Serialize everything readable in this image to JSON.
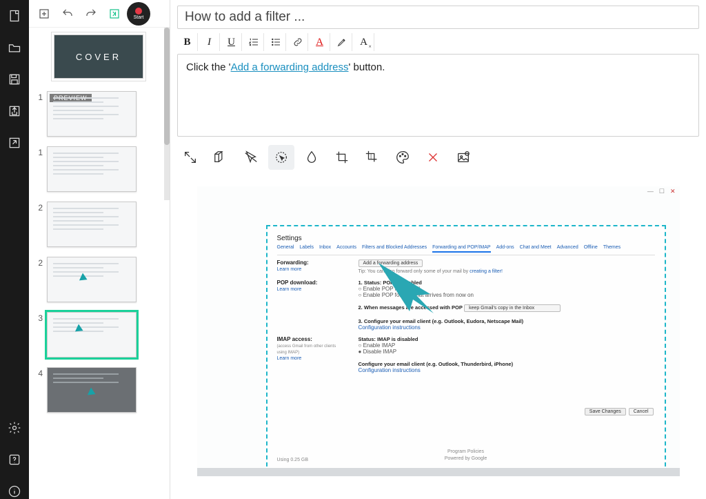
{
  "rail": {
    "items": [
      "new-doc",
      "open",
      "save",
      "export",
      "share",
      "settings",
      "help",
      "info"
    ],
    "record_label": "Start"
  },
  "toolbar": {
    "add": "+",
    "undo": "undo",
    "redo": "redo",
    "merge": "merge"
  },
  "cover_label": "COVER",
  "steps": [
    {
      "num": "1",
      "preview": true
    },
    {
      "num": "1"
    },
    {
      "num": "2"
    },
    {
      "num": "2"
    },
    {
      "num": "3",
      "selected": true
    },
    {
      "num": "4",
      "dark": true
    }
  ],
  "preview_tag": "PREVIEW",
  "title": "How to add a filter ...",
  "format": {
    "bold": "B",
    "italic": "I",
    "underline": "U",
    "ol": "list-ol",
    "ul": "list-ul",
    "link": "link",
    "color": "A",
    "highlight": "highlight",
    "clear": "A×"
  },
  "description": {
    "pre": "Click the '",
    "link": "Add a forwarding address",
    "post": "' button."
  },
  "imgtools": [
    "expand",
    "rect",
    "pointer",
    "spotlight",
    "blur",
    "crop",
    "multicrop",
    "palette",
    "delete",
    "replace"
  ],
  "settings": {
    "heading": "Settings",
    "tabs": [
      "General",
      "Labels",
      "Inbox",
      "Accounts",
      "Filters and Blocked Addresses",
      "Forwarding and POP/IMAP",
      "Add-ons",
      "Chat and Meet",
      "Advanced",
      "Offline",
      "Themes"
    ],
    "active_tab": "Forwarding and POP/IMAP",
    "forwarding": {
      "label": "Forwarding:",
      "learn": "Learn more",
      "button": "Add a forwarding address",
      "tip_pre": "Tip: You can also forward only some of your mail by ",
      "tip_link": "creating a filter!"
    },
    "pop": {
      "label": "POP download:",
      "learn": "Learn more",
      "status": "1. Status: POP is disabled",
      "opt1": "Enable POP for all mail",
      "opt2": "Enable POP for mail that arrives from now on",
      "when": "2. When messages are accessed with POP",
      "when_sel": "keep Gmail's copy in the Inbox",
      "conf": "3. Configure your email client (e.g. Outlook, Eudora, Netscape Mail)",
      "conf_link": "Configuration instructions"
    },
    "imap": {
      "label": "IMAP access:",
      "sub": "(access Gmail from other clients using IMAP)",
      "learn": "Learn more",
      "status": "Status: IMAP is disabled",
      "opt1": "Enable IMAP",
      "opt2": "Disable IMAP",
      "conf": "Configure your email client (e.g. Outlook, Thunderbird, iPhone)",
      "conf_link": "Configuration instructions"
    },
    "save_btn": "Save Changes",
    "cancel_btn": "Cancel",
    "usage": "Using 0.25 GB",
    "policies": "Program Policies",
    "powered": "Powered by Google"
  }
}
